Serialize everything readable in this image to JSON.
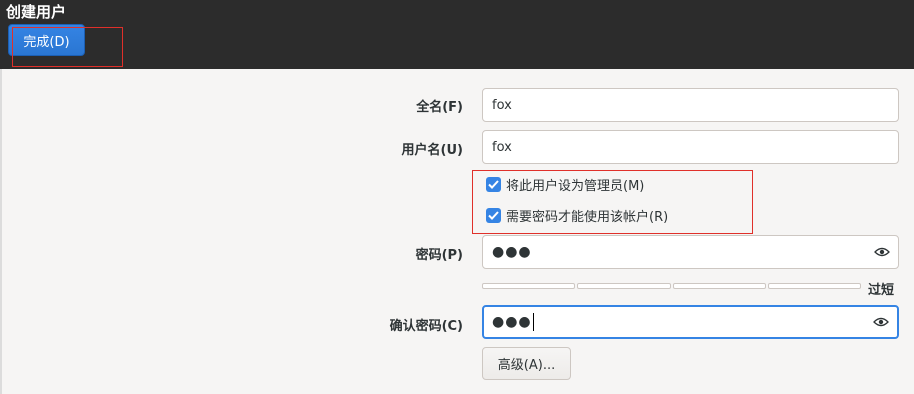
{
  "header": {
    "title": "创建用户",
    "done_label": "完成(D)"
  },
  "form": {
    "fullname_label": "全名(F)",
    "fullname_value": "fox",
    "username_label": "用户名(U)",
    "username_value": "fox",
    "admin_checkbox": {
      "label": "将此用户设为管理员(M)",
      "checked": true
    },
    "require_password_checkbox": {
      "label": "需要密码才能使用该帐户(R)",
      "checked": true
    },
    "password_label": "密码(P)",
    "password_value": "●●●",
    "strength_text": "过短",
    "confirm_label": "确认密码(C)",
    "confirm_value": "●●●",
    "advanced_label": "高级(A)..."
  },
  "colors": {
    "accent": "#3584e4",
    "header_bg": "#2c2c2c",
    "highlight": "#e0302a"
  },
  "icons": {
    "eye": "eye-icon",
    "check": "checkmark-icon"
  }
}
